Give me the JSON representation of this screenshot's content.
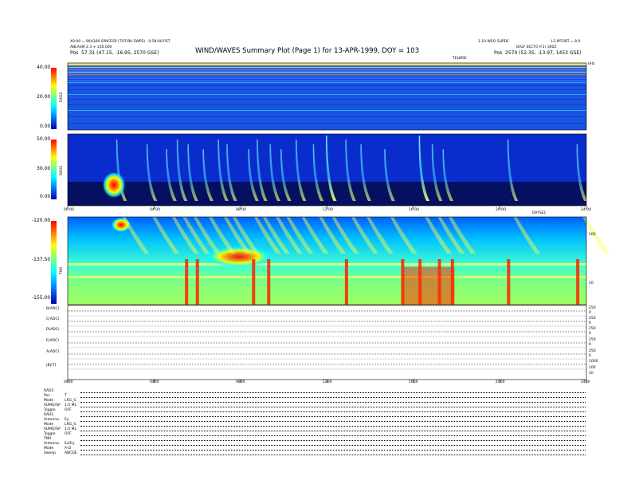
{
  "header": {
    "left_line1": "X0:00 = 90LQ00 SPACESP (TOT/90 SWPS) · 0:58:00 PST",
    "left_line2": "ABLASM 2.3 + 130.000",
    "left_line3_label": "Pos",
    "left_line3_value": "57.31 (47.15, -16.95, 2570 GSE)",
    "title": "WIND/WAVES Summary Plot (Page 1) for 13-APR-1999, DOY = 103",
    "right_line1": "1.10 WSO SUPDC",
    "right_line1b": "L3 MTORT = 8.0",
    "right_line2": "DALY SECT0 (F1) 300Z",
    "right_line3_label": "Pos",
    "right_line3_value": "2570 (52.35, -13.97, 1453 GSE)",
    "tile_note": "TELWSE",
    "khz_note": "kHz"
  },
  "panels": {
    "rad2": {
      "label": "RAD2",
      "ticks": [
        "40.00",
        "20.00",
        "0.00"
      ]
    },
    "rad1": {
      "label": "RAD1",
      "ticks": [
        "50.00",
        "30.00",
        "0.00"
      ]
    },
    "tnr": {
      "label": "TNR",
      "ticks": [
        "-120.00",
        "-137.50",
        "-155.00"
      ],
      "right_ticks": [
        "100",
        "10"
      ]
    },
    "time_ticks_mid": [
      "00:00",
      "04:00",
      "08:00",
      "12:00",
      "16:00",
      "20:00",
      "24:00"
    ],
    "time_note_mid": "DAYSEC",
    "line_labels": [
      "B(ADC)",
      "C(ADC)",
      "D(ADC)",
      "E(ADC)",
      "A(ADC)",
      "|B|(T)"
    ],
    "line_right_ticks": [
      [
        "250",
        "0"
      ],
      [
        "250",
        "0"
      ],
      [
        "250",
        "0"
      ],
      [
        "250",
        "0"
      ],
      [
        "250",
        "0"
      ],
      [
        "1000",
        "100",
        "10"
      ]
    ],
    "time_ticks_bottom": [
      "0000",
      "0400",
      "0800",
      "1200",
      "1600",
      "2000",
      "2400"
    ]
  },
  "footer": {
    "rows": [
      {
        "label": "RAD2"
      },
      {
        "label": "Pos",
        "value": "T"
      },
      {
        "label": "Mode",
        "value": "LRG_S"
      },
      {
        "label": "SUMO/SP",
        "value": "1.0 ML"
      },
      {
        "label": "Toggle",
        "value": "OFF"
      },
      {
        "label": "RAD1"
      },
      {
        "label": "Antenna",
        "value": "Ey"
      },
      {
        "label": "Mode",
        "value": "LRG_S"
      },
      {
        "label": "SUMO/SP",
        "value": "1.0 ML"
      },
      {
        "label": "Toggle",
        "value": "OFF"
      },
      {
        "label": "TNR"
      },
      {
        "label": "Antenna",
        "value": "Ex/Ey"
      },
      {
        "label": "Mode",
        "value": "A-D"
      },
      {
        "label": "Sweep",
        "value": "ABCDE"
      }
    ]
  },
  "chart_data": {
    "type": "heatmap",
    "title": "WIND/WAVES Summary Plot (Page 1) for 13-APR-1999, DOY = 103",
    "x_range_hours": [
      0,
      24
    ],
    "panels": [
      {
        "name": "RAD2",
        "y_range": [
          0,
          40
        ]
      },
      {
        "name": "RAD1",
        "y_range": [
          0,
          50
        ]
      },
      {
        "name": "TNR",
        "y_range": [
          -155,
          -120
        ]
      }
    ],
    "type3_burst_times_hours": [
      2.3,
      3.7,
      4.6,
      5.1,
      5.6,
      6.3,
      7.0,
      7.4,
      8.4,
      8.8,
      9.4,
      9.9,
      10.6,
      11.4,
      12.0,
      12.9,
      13.6,
      14.7,
      16.3,
      16.9,
      17.4,
      20.4,
      23.6
    ],
    "tnr_noise_times_hours": [
      5.5,
      6.0,
      8.6,
      9.3,
      12.9,
      15.5,
      16.3,
      17.2,
      17.8,
      20.4,
      23.6
    ],
    "colorbar": [
      "#0000aa",
      "#0080ff",
      "#00ffff",
      "#80ff80",
      "#ffff00",
      "#ff8000",
      "#ff0000"
    ]
  }
}
